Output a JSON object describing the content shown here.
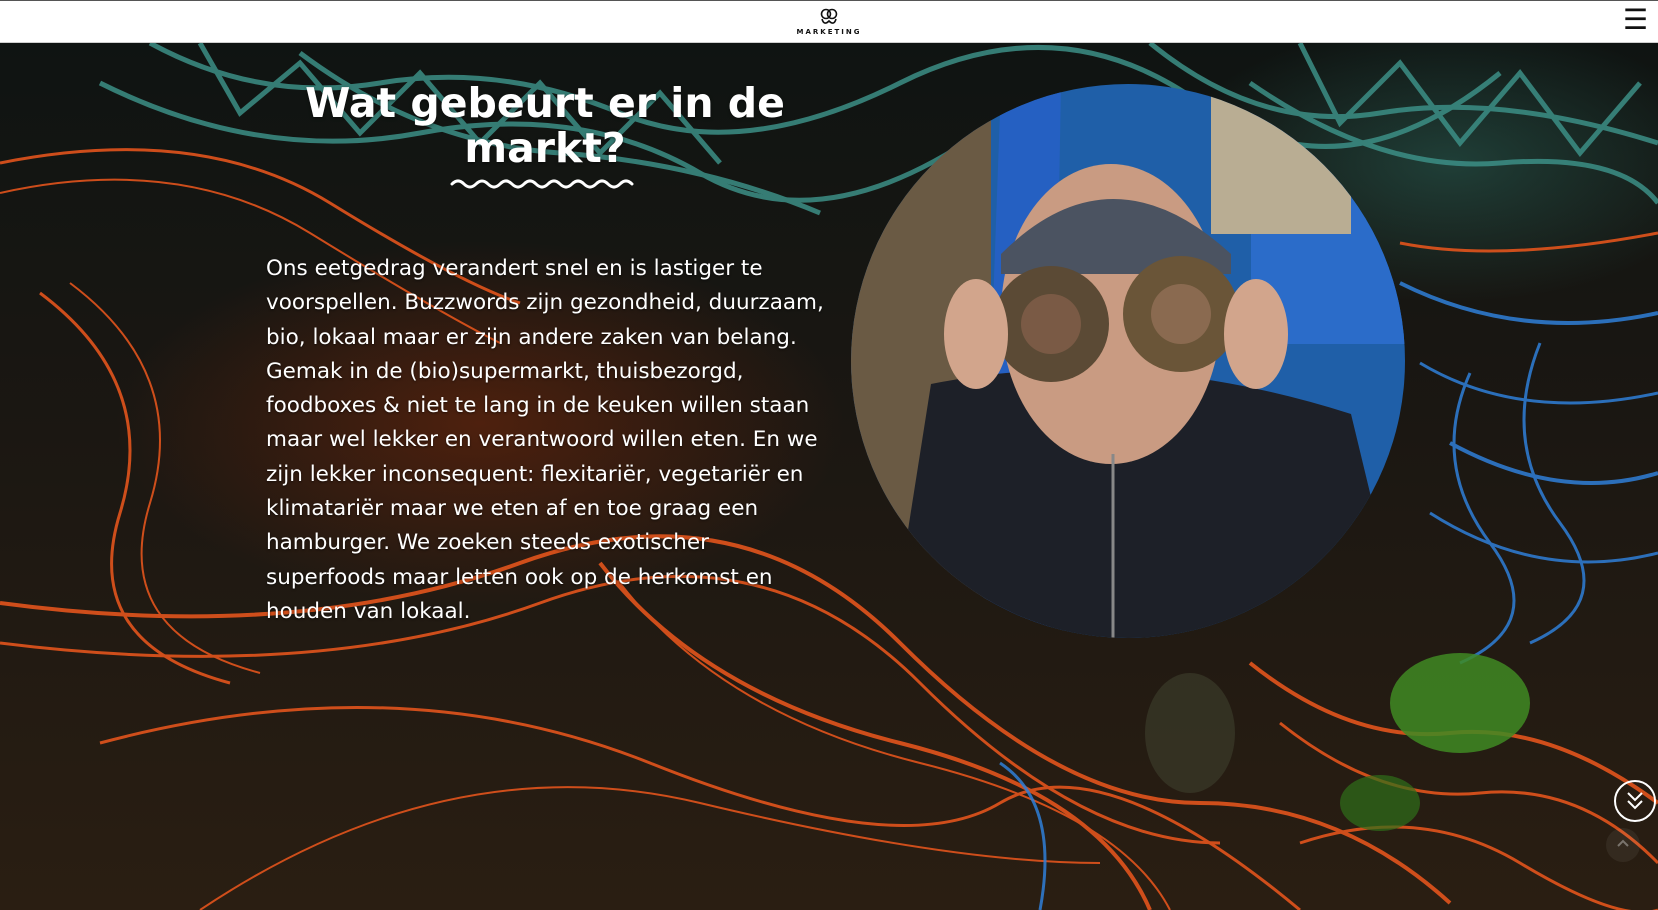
{
  "header": {
    "logo_text": "MARKETING",
    "menu_icon": "☰"
  },
  "hero": {
    "title": "Wat gebeurt er in de markt?",
    "body": "Ons eetgedrag verandert snel en is lastiger te voorspellen. Buzzwords zijn gezondheid, duurzaam, bio, lokaal maar er zijn andere zaken van belang. Gemak in de (bio)supermarkt, thuisbezorgd, foodboxes & niet te lang in de keuken willen staan maar wel lekker en verantwoord willen eten. En we zijn lekker inconsequent: flexitariër, vegetariër en klimatariër maar we eten af en toe graag een hamburger. We zoeken steeds exotischer superfoods maar letten ook op de herkomst en houden van lokaal.",
    "photo_icon": "person-with-binoculars-photo",
    "scroll_down_icon": "double-chevron-down-icon",
    "back_to_top_icon": "chevron-up-icon"
  },
  "colors": {
    "header_bg": "#ffffff",
    "text": "#ffffff",
    "accent_orange": "#e2541c",
    "accent_blue": "#2f7fd8",
    "accent_teal": "#3c8f86"
  }
}
